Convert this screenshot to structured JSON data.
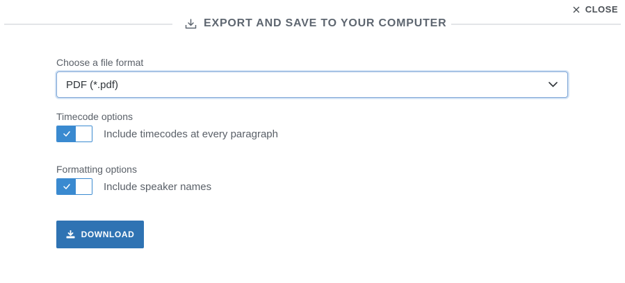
{
  "header": {
    "title": "EXPORT AND SAVE TO YOUR COMPUTER",
    "icon": "download-tray-icon",
    "close_label": "CLOSE",
    "close_icon": "close-icon"
  },
  "format": {
    "label": "Choose a file format",
    "selected": "PDF (*.pdf)",
    "dropdown_icon": "chevron-down-icon"
  },
  "timecode": {
    "label": "Timecode options",
    "option_text": "Include timecodes at every paragraph",
    "enabled": true
  },
  "formatting": {
    "label": "Formatting options",
    "option_text": "Include speaker names",
    "enabled": true
  },
  "download": {
    "label": "DOWNLOAD",
    "icon": "download-icon"
  },
  "colors": {
    "accent": "#3a8ad0",
    "button": "#2f73b3",
    "divider": "#e3e5e8",
    "text": "#5a6068"
  }
}
